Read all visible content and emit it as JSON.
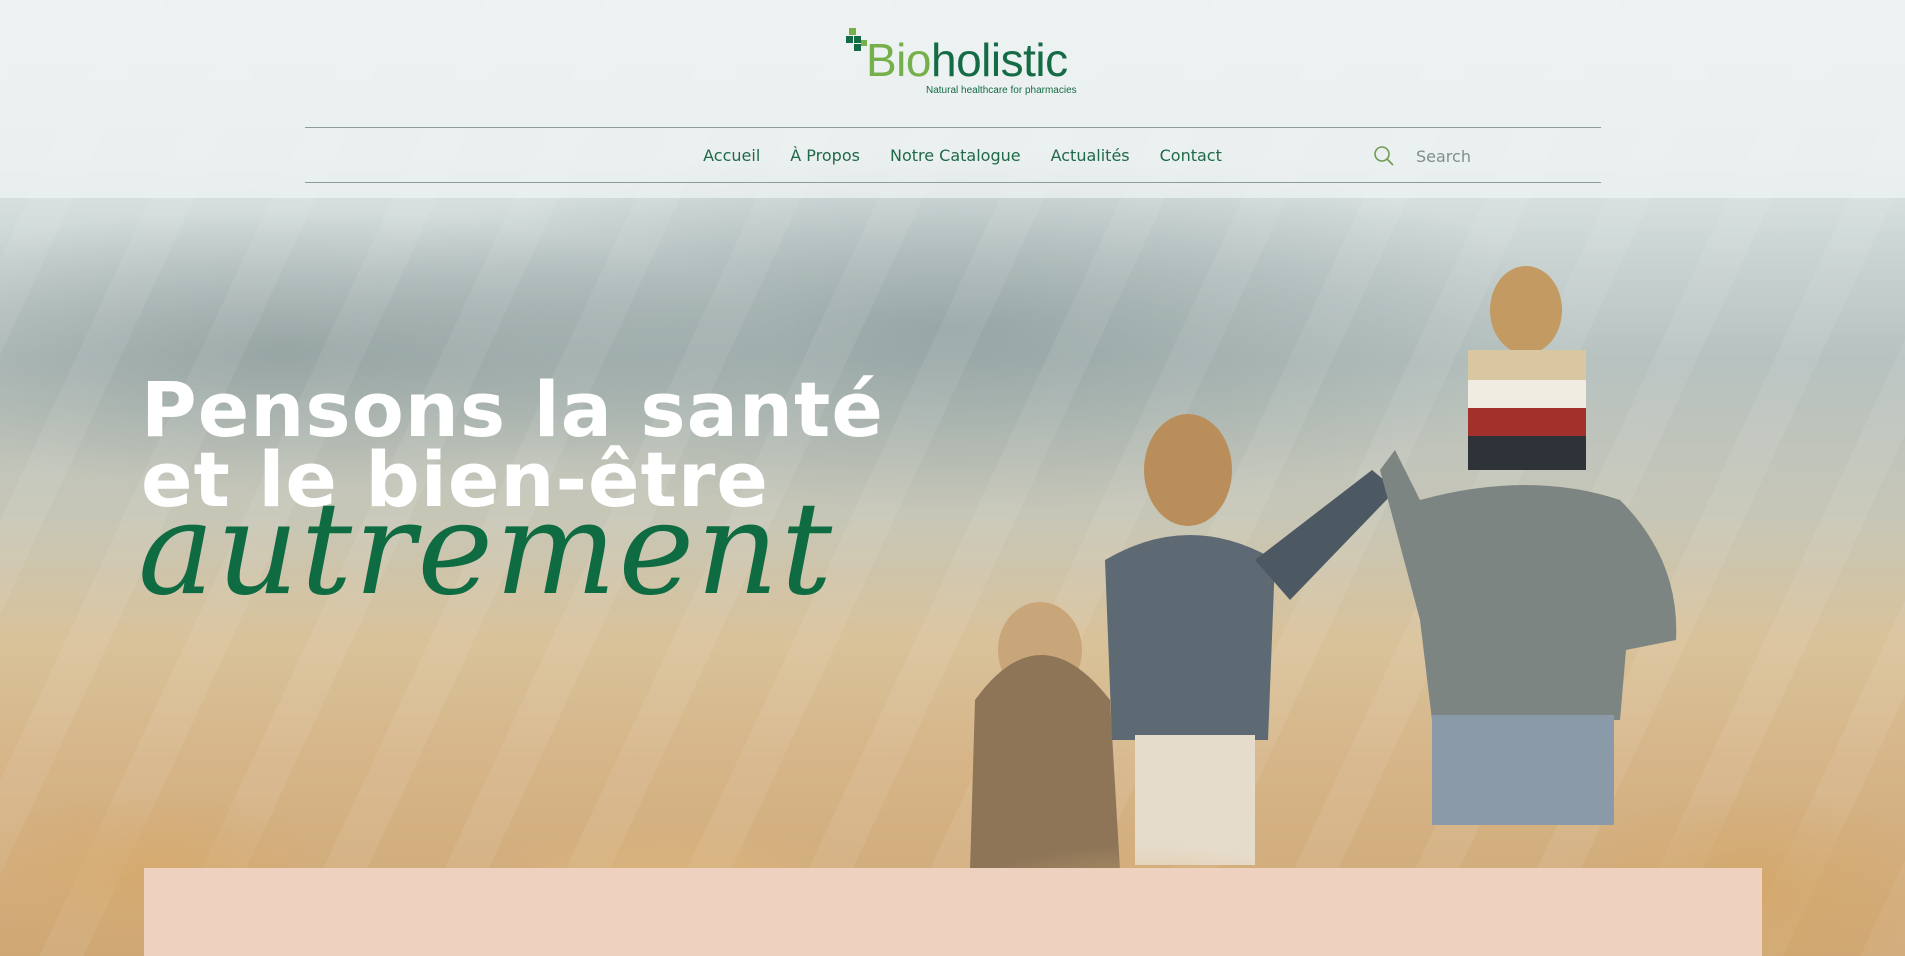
{
  "brand": {
    "name_part1": "Bio",
    "name_part2": "holistic",
    "tagline": "Natural healthcare for pharmacies",
    "colors": {
      "primary_green": "#146b45",
      "accent_green": "#76b04a",
      "card_pink": "#efd1bf"
    }
  },
  "nav": {
    "items": [
      {
        "label": "Accueil"
      },
      {
        "label": "À Propos"
      },
      {
        "label": "Notre Catalogue"
      },
      {
        "label": "Actualités"
      },
      {
        "label": "Contact"
      }
    ]
  },
  "search": {
    "placeholder": "Search",
    "icon": "search-icon"
  },
  "hero": {
    "line1": "Pensons la santé",
    "line2": "et le bien-être",
    "script": "autrement"
  }
}
